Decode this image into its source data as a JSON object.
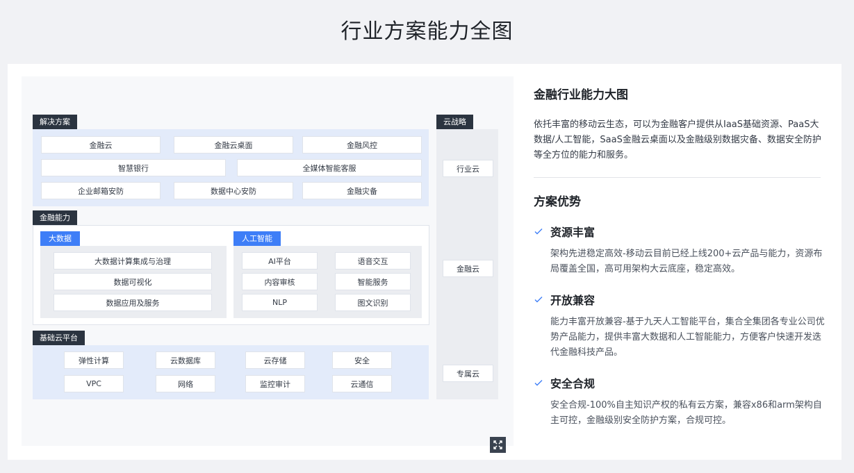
{
  "page": {
    "title": "行业方案能力全图"
  },
  "diagram": {
    "solutions": {
      "label": "解决方案",
      "items": [
        "金融云",
        "金融云桌面",
        "金融风控",
        "智慧银行",
        "全媒体智能客服",
        "企业邮箱安防",
        "数据中心安防",
        "金融灾备"
      ]
    },
    "finance": {
      "label": "金融能力",
      "bigdata": {
        "label": "大数据",
        "items": [
          "大数据计算集成与治理",
          "数据可视化",
          "数据应用及服务"
        ]
      },
      "ai": {
        "label": "人工智能",
        "items": [
          "AI平台",
          "语音交互",
          "内容审核",
          "智能服务",
          "NLP",
          "图文识别"
        ]
      }
    },
    "base": {
      "label": "基础云平台",
      "items": [
        "弹性计算",
        "云数据库",
        "云存储",
        "安全",
        "VPC",
        "网络",
        "监控审计",
        "云通信"
      ]
    },
    "strategy": {
      "label": "云战略",
      "items": [
        "行业云",
        "金融云",
        "专属云"
      ]
    },
    "expand_icon": "expand-icon"
  },
  "panel": {
    "title": "金融行业能力大图",
    "description": "依托丰富的移动云生态，可以为金融客户提供从IaaS基础资源、PaaS大数据/人工智能，SaaS金融云桌面以及金融级别数据灾备、数据安全防护等全方位的能力和服务。",
    "advantages_title": "方案优势",
    "advantages": [
      {
        "name": "资源丰富",
        "text": "架构先进稳定高效-移动云目前已经上线200+云产品与能力，资源布局覆盖全国，高可用架构大云底座，稳定高效。"
      },
      {
        "name": "开放兼容",
        "text": "能力丰富开放兼容-基于九天人工智能平台，集合全集团各专业公司优势产品能力，提供丰富大数据和人工智能能力，方便客户快速开发迭代金融科技产品。"
      },
      {
        "name": "安全合规",
        "text": "安全合规-100%自主知识产权的私有云方案，兼容x86和arm架构自主可控，金融级别安全防护方案，合规可控。"
      }
    ]
  },
  "colors": {
    "accent": "#3e7ef7",
    "tag_dark": "#2b3440",
    "region_blue": "#e3ebfa",
    "region_gray": "#ebedf1"
  }
}
